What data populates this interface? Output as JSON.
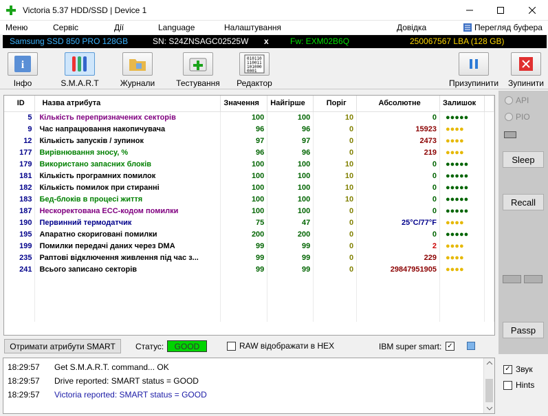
{
  "window": {
    "title": "Victoria 5.37 HDD/SSD | Device 1"
  },
  "menu": {
    "items": [
      "Меню",
      "Сервіс",
      "Дії",
      "Language",
      "Налаштування",
      "Довідка"
    ],
    "clipboard": "Перегляд буфера"
  },
  "infobar": {
    "model": "Samsung SSD 850 PRO 128GB",
    "serial": "SN: S24ZNSAGC02525W",
    "x": "x",
    "firmware": "Fw: EXM02B6Q",
    "lba": "250067567 LBA (128 GB)"
  },
  "toolbar": {
    "info": "Інфо",
    "smart": "S.M.A.R.T",
    "logs": "Журнали",
    "tests": "Тестування",
    "editor": "Редактор",
    "pause": "Призупинити",
    "stop": "Зупинити"
  },
  "table": {
    "headers": [
      "ID",
      "Назва атрибута",
      "Значення",
      "Найгірше",
      "Поріг",
      "Абсолютне",
      "Залишок"
    ],
    "rows": [
      {
        "id": "5",
        "name": "Кількість перепризначених секторів",
        "value": "100",
        "worst": "100",
        "thr": "10",
        "abs": "0",
        "dots": "●●●●●",
        "nc": "#800080",
        "ac": "#006400",
        "dc": "#006400"
      },
      {
        "id": "9",
        "name": "Час напрацювання накопичувача",
        "value": "96",
        "worst": "96",
        "thr": "0",
        "abs": "15923",
        "dots": "●●●●",
        "nc": "#000000",
        "ac": "#8b0000",
        "dc": "#e6b800"
      },
      {
        "id": "12",
        "name": "Кількість запусків / зупинок",
        "value": "97",
        "worst": "97",
        "thr": "0",
        "abs": "2473",
        "dots": "●●●●",
        "nc": "#000000",
        "ac": "#8b0000",
        "dc": "#e6b800"
      },
      {
        "id": "177",
        "name": "Вирівнювання зносу, %",
        "value": "96",
        "worst": "96",
        "thr": "0",
        "abs": "219",
        "dots": "●●●●",
        "nc": "#008000",
        "ac": "#8b0000",
        "dc": "#e6b800"
      },
      {
        "id": "179",
        "name": "Використано запасних блоків",
        "value": "100",
        "worst": "100",
        "thr": "10",
        "abs": "0",
        "dots": "●●●●●",
        "nc": "#008000",
        "ac": "#006400",
        "dc": "#006400"
      },
      {
        "id": "181",
        "name": "Кількість програмних помилок",
        "value": "100",
        "worst": "100",
        "thr": "10",
        "abs": "0",
        "dots": "●●●●●",
        "nc": "#000000",
        "ac": "#006400",
        "dc": "#006400"
      },
      {
        "id": "182",
        "name": "Кількість помилок при стиранні",
        "value": "100",
        "worst": "100",
        "thr": "10",
        "abs": "0",
        "dots": "●●●●●",
        "nc": "#000000",
        "ac": "#006400",
        "dc": "#006400"
      },
      {
        "id": "183",
        "name": "Бед-блоків в процесі життя",
        "value": "100",
        "worst": "100",
        "thr": "10",
        "abs": "0",
        "dots": "●●●●●",
        "nc": "#008000",
        "ac": "#006400",
        "dc": "#006400"
      },
      {
        "id": "187",
        "name": "Нескоректована ECC-кодом помилки",
        "value": "100",
        "worst": "100",
        "thr": "0",
        "abs": "0",
        "dots": "●●●●●",
        "nc": "#800080",
        "ac": "#006400",
        "dc": "#006400"
      },
      {
        "id": "190",
        "name": "Первинний термодатчик",
        "value": "75",
        "worst": "47",
        "thr": "0",
        "abs": "25°C/77°F",
        "dots": "●●●●",
        "nc": "#00008b",
        "ac": "#00008b",
        "dc": "#e6b800"
      },
      {
        "id": "195",
        "name": "Апаратно скориговані помилки",
        "value": "200",
        "worst": "200",
        "thr": "0",
        "abs": "0",
        "dots": "●●●●●",
        "nc": "#000000",
        "ac": "#006400",
        "dc": "#006400"
      },
      {
        "id": "199",
        "name": "Помилки передачі даних через DMA",
        "value": "99",
        "worst": "99",
        "thr": "0",
        "abs": "2",
        "dots": "●●●●",
        "nc": "#000000",
        "ac": "#cc0000",
        "dc": "#e6b800"
      },
      {
        "id": "235",
        "name": "Раптові відключення живлення під час з...",
        "value": "99",
        "worst": "99",
        "thr": "0",
        "abs": "229",
        "dots": "●●●●",
        "nc": "#000000",
        "ac": "#8b0000",
        "dc": "#e6b800"
      },
      {
        "id": "241",
        "name": "Всього записано секторів",
        "value": "99",
        "worst": "99",
        "thr": "0",
        "abs": "29847951905",
        "dots": "●●●●",
        "nc": "#000000",
        "ac": "#8b0000",
        "dc": "#e6b800"
      }
    ]
  },
  "rightpanel": {
    "api": "API",
    "pio": "PIO",
    "sleep": "Sleep",
    "recall": "Recall",
    "passp": "Passp"
  },
  "bottom": {
    "get_smart": "Отримати атрибути SMART",
    "status_label": "Статус:",
    "status_value": "GOOD",
    "raw_hex": "RAW відображати в HEX",
    "ibm": "IBM super smart:"
  },
  "log": [
    {
      "time": "18:29:57",
      "msg": "Get S.M.A.R.T. command... OK",
      "color": "#000000"
    },
    {
      "time": "18:29:57",
      "msg": "Drive reported: SMART status = GOOD",
      "color": "#000000"
    },
    {
      "time": "18:29:57",
      "msg": "Victoria reported: SMART status = GOOD",
      "color": "#1a1aa6"
    }
  ],
  "side_checks": {
    "sound": "Звук",
    "hints": "Hints"
  }
}
